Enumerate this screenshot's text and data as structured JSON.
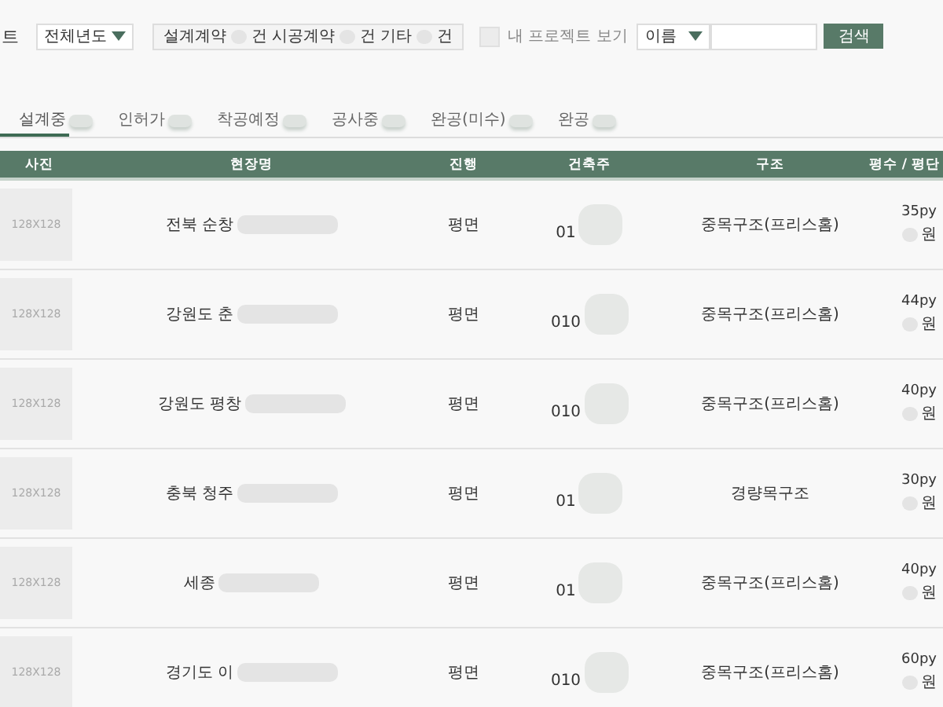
{
  "page_title": "트",
  "year_filter": {
    "value": "전체년도"
  },
  "contract_counts": [
    {
      "label": "설계계약",
      "unit": "건"
    },
    {
      "label": "시공계약",
      "unit": "건"
    },
    {
      "label": "기타",
      "unit": "건"
    }
  ],
  "my_projects": {
    "label": "내 프로젝트 보기",
    "checked": false
  },
  "search": {
    "field": "이름",
    "button": "검색"
  },
  "tabs": [
    {
      "label": "설계중",
      "selected": true
    },
    {
      "label": "인허가",
      "selected": false
    },
    {
      "label": "착공예정",
      "selected": false
    },
    {
      "label": "공사중",
      "selected": false
    },
    {
      "label": "완공(미수)",
      "selected": false
    },
    {
      "label": "완공",
      "selected": false
    }
  ],
  "table": {
    "columns": [
      "사진",
      "현장명",
      "진행",
      "건축주",
      "구조",
      "평수 / 평단"
    ],
    "rows": [
      {
        "photo": "128X128",
        "site": "전북 순창",
        "progress": "평면",
        "owner": "01",
        "structure": "중목구조(프리스홈)",
        "area": "35py",
        "price_unit": "원"
      },
      {
        "photo": "128X128",
        "site": "강원도 춘",
        "progress": "평면",
        "owner": "010",
        "structure": "중목구조(프리스홈)",
        "area": "44py",
        "price_unit": "원"
      },
      {
        "photo": "128X128",
        "site": "강원도 평창",
        "progress": "평면",
        "owner": "010",
        "structure": "중목구조(프리스홈)",
        "area": "40py",
        "price_unit": "원"
      },
      {
        "photo": "128X128",
        "site": "충북 청주",
        "progress": "평면",
        "owner": "01",
        "structure": "경량목구조",
        "area": "30py",
        "price_unit": "원"
      },
      {
        "photo": "128X128",
        "site": "세종",
        "progress": "평면",
        "owner": "01",
        "structure": "중목구조(프리스홈)",
        "area": "40py",
        "price_unit": "원"
      },
      {
        "photo": "128X128",
        "site": "경기도 이",
        "progress": "평면",
        "owner": "010",
        "structure": "중목구조(프리스홈)",
        "area": "60py",
        "price_unit": "원"
      }
    ]
  }
}
